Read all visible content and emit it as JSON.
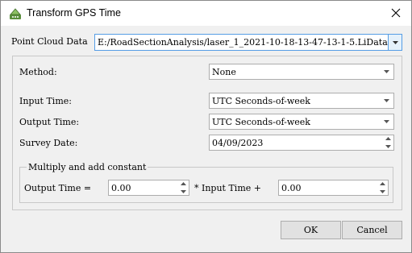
{
  "window": {
    "title": "Transform GPS Time",
    "icon": "app-icon",
    "close_icon": "close-icon"
  },
  "point_cloud": {
    "label": "Point Cloud Data",
    "value": "E:/RoadSectionAnalysis/laser_1_2021-10-18-13-47-13-1-5.LiData"
  },
  "method": {
    "label": "Method:",
    "value": "None"
  },
  "input_time": {
    "label": "Input Time:",
    "value": "UTC Seconds-of-week"
  },
  "output_time": {
    "label": "Output Time:",
    "value": "UTC Seconds-of-week"
  },
  "survey_date": {
    "label": "Survey Date:",
    "value": "04/09/2023"
  },
  "constant_group": {
    "title": "Multiply and add constant",
    "output_label": "Output Time =",
    "multiplier": "0.00",
    "input_label": "* Input Time +",
    "constant": "0.00"
  },
  "buttons": {
    "ok": "OK",
    "cancel": "Cancel"
  }
}
